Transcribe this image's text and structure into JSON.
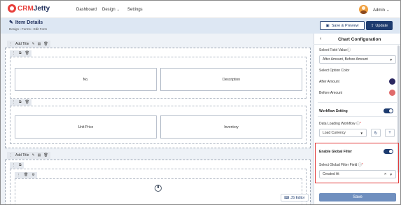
{
  "app": {
    "logo_prefix": "CRM",
    "logo_suffix": "Jetty",
    "nav": {
      "dashboard": "Dashboard",
      "design": "Design",
      "settings": "Settings"
    },
    "user": "Admin"
  },
  "header": {
    "title": "Item Details",
    "breadcrumb": "Design  ›  Forms  ›  Edit Form",
    "save_preview_label": "Save & Preview",
    "update_label": "Update"
  },
  "canvas": {
    "section_title": "Add Title",
    "sections": [
      {
        "cells": [
          "No.",
          "Description"
        ]
      },
      {
        "cells": [
          "Unit Price",
          "Inventory"
        ]
      }
    ],
    "js_editor_label": "JS Editor"
  },
  "panel": {
    "title": "Chart Configuration",
    "field_value_label": "Select Field Value",
    "field_value": "After Amount, Before Amount",
    "option_color_label": "Select Option Color",
    "options": [
      {
        "label": "After Amount",
        "color": "#2b2760"
      },
      {
        "label": "Before Amount",
        "color": "#e06b6b"
      }
    ],
    "workflow_setting_label": "Workflow Setting",
    "workflow_enabled": true,
    "data_loading_label": "Data Loading Workflow",
    "data_loading_value": "Load Currency",
    "global_filter_label": "Enable Global Filter",
    "global_filter_enabled": true,
    "global_filter_field_label": "Select Global Filter Field",
    "global_filter_field_value": "Created At",
    "save_label": "Save"
  },
  "colors": {
    "brand_navy": "#1d3b6f",
    "brand_red": "#e8403c",
    "highlight": "#e23b3b",
    "header_band": "#dde7f3"
  }
}
